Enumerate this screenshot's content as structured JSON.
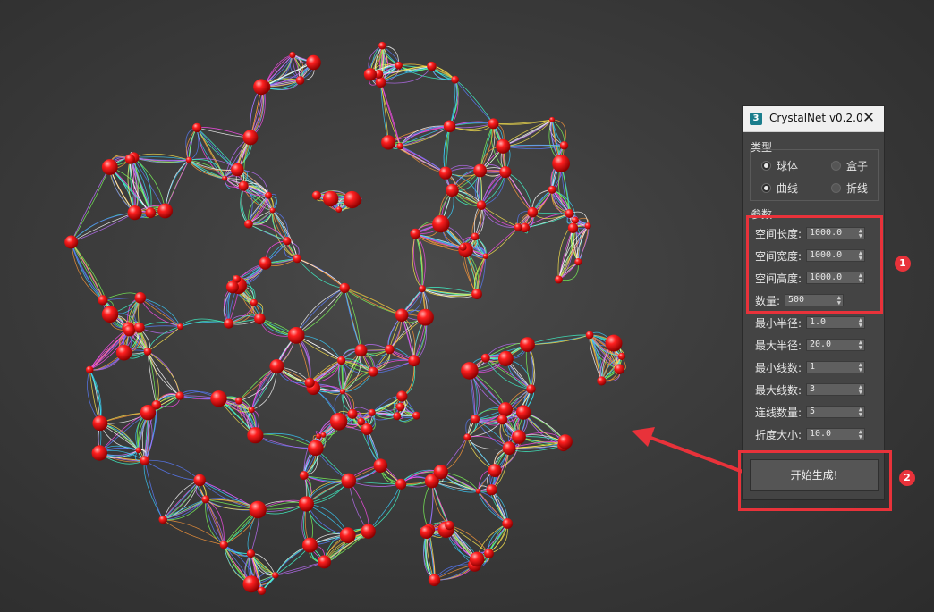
{
  "window": {
    "title": "CrystalNet v0.2.0",
    "icon": "3",
    "close_glyph": "✕"
  },
  "type_group": {
    "label": "类型",
    "options": [
      {
        "label": "球体",
        "selected": true
      },
      {
        "label": "盒子",
        "selected": false
      },
      {
        "label": "曲线",
        "selected": true
      },
      {
        "label": "折线",
        "selected": false
      }
    ]
  },
  "params_group": {
    "label": "参数",
    "fields": [
      {
        "label": "空间长度:",
        "value": "1000.0"
      },
      {
        "label": "空间宽度:",
        "value": "1000.0"
      },
      {
        "label": "空间高度:",
        "value": "1000.0"
      },
      {
        "label": "数量:",
        "value": "500"
      },
      {
        "label": "最小半径:",
        "value": "1.0"
      },
      {
        "label": "最大半径:",
        "value": "20.0"
      },
      {
        "label": "最小线数:",
        "value": "1"
      },
      {
        "label": "最大线数:",
        "value": "3"
      },
      {
        "label": "连线数量:",
        "value": "5"
      },
      {
        "label": "折度大小:",
        "value": "10.0"
      }
    ]
  },
  "generate_button": {
    "label": "开始生成!"
  },
  "annotations": {
    "marker_1": "1",
    "marker_2": "2",
    "highlight_color": "#e8323a"
  },
  "viewport": {
    "background": "#3c3c3c",
    "node_color": "#ff1f1f"
  }
}
